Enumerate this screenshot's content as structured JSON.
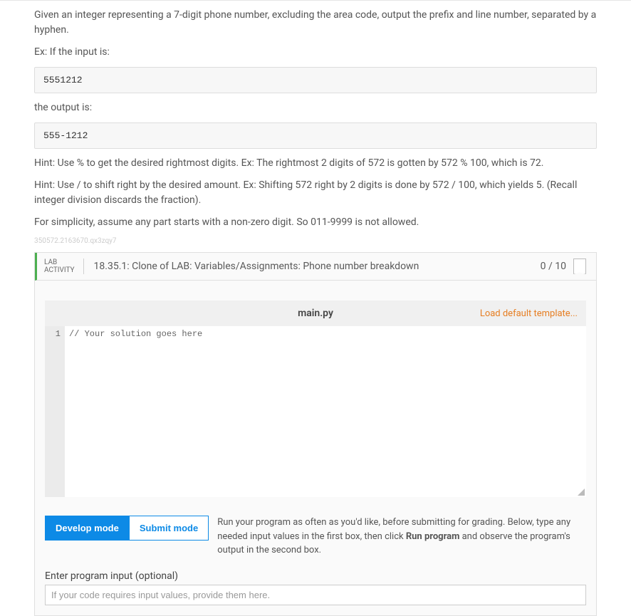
{
  "problem": {
    "intro": "Given an integer representing a 7-digit phone number, excluding the area code, output the prefix and line number, separated by a hyphen.",
    "ex_label": "Ex: If the input is:",
    "input_example": "5551212",
    "output_label": "the output is:",
    "output_example": "555-1212",
    "hint1": "Hint: Use % to get the desired rightmost digits. Ex: The rightmost 2 digits of 572 is gotten by 572 % 100, which is 72.",
    "hint2": "Hint: Use / to shift right by the desired amount. Ex: Shifting 572 right by 2 digits is done by 572 / 100, which yields 5. (Recall integer division discards the fraction).",
    "simplicity": "For simplicity, assume any part starts with a non-zero digit. So 011-9999 is not allowed.",
    "watermark": "350572.2163670.qx3zqy7"
  },
  "lab": {
    "tag_line1": "LAB",
    "tag_line2": "ACTIVITY",
    "title": "18.35.1: Clone of LAB: Variables/Assignments: Phone number breakdown",
    "score": "0 / 10"
  },
  "editor": {
    "filename": "main.py",
    "reset_link": "Load default template...",
    "line_number": "1",
    "code_line": "// Your solution goes here"
  },
  "modes": {
    "develop": "Develop mode",
    "submit": "Submit mode",
    "description_pre": "Run your program as often as you'd like, before submitting for grading. Below, type any needed input values in the first box, then click ",
    "description_bold": "Run program",
    "description_post": " and observe the program's output in the second box."
  },
  "input": {
    "label": "Enter program input (optional)",
    "placeholder": "If your code requires input values, provide them here."
  }
}
